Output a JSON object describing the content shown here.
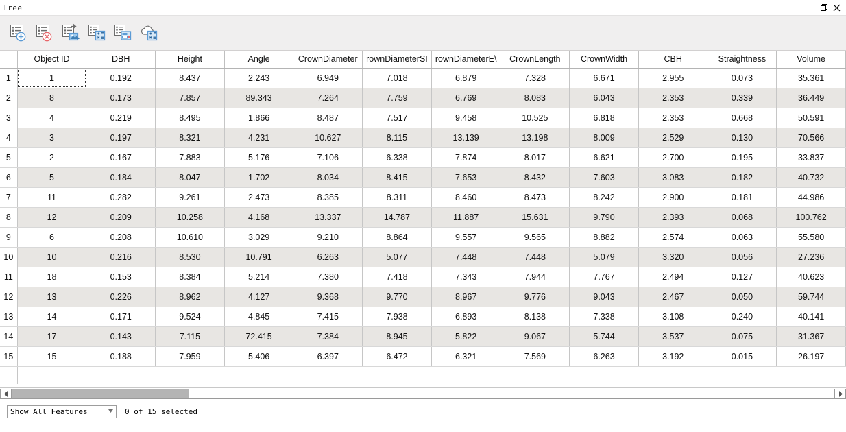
{
  "window": {
    "title": "Tree",
    "restore_icon": "restore-window-icon",
    "close_icon": "close-icon"
  },
  "toolbar": {
    "buttons": [
      {
        "name": "add-record-button",
        "icon": "list-add-icon",
        "title": "Add Record"
      },
      {
        "name": "delete-record-button",
        "icon": "list-delete-icon",
        "title": "Delete Record"
      },
      {
        "name": "export-records-button",
        "icon": "list-export-icon",
        "title": "Export Records"
      },
      {
        "name": "add-field-button",
        "icon": "list-calculate-icon",
        "title": "Add Field"
      },
      {
        "name": "delete-field-button",
        "icon": "list-remove-field-icon",
        "title": "Delete Field"
      },
      {
        "name": "calculate-field-button",
        "icon": "cloud-calculate-icon",
        "title": "Calculate Field"
      }
    ]
  },
  "table": {
    "columns": [
      "Object ID",
      "DBH",
      "Height",
      "Angle",
      "CrownDiameter",
      "rownDiameterSI",
      "rownDiameterE\\",
      "CrownLength",
      "CrownWidth",
      "CBH",
      "Straightness",
      "Volume"
    ],
    "row_numbers": [
      "1",
      "2",
      "3",
      "4",
      "5",
      "6",
      "7",
      "8",
      "9",
      "10",
      "11",
      "12",
      "13",
      "14",
      "15"
    ],
    "rows": [
      [
        "1",
        "0.192",
        "8.437",
        "2.243",
        "6.949",
        "7.018",
        "6.879",
        "7.328",
        "6.671",
        "2.955",
        "0.073",
        "35.361"
      ],
      [
        "8",
        "0.173",
        "7.857",
        "89.343",
        "7.264",
        "7.759",
        "6.769",
        "8.083",
        "6.043",
        "2.353",
        "0.339",
        "36.449"
      ],
      [
        "4",
        "0.219",
        "8.495",
        "1.866",
        "8.487",
        "7.517",
        "9.458",
        "10.525",
        "6.818",
        "2.353",
        "0.668",
        "50.591"
      ],
      [
        "3",
        "0.197",
        "8.321",
        "4.231",
        "10.627",
        "8.115",
        "13.139",
        "13.198",
        "8.009",
        "2.529",
        "0.130",
        "70.566"
      ],
      [
        "2",
        "0.167",
        "7.883",
        "5.176",
        "7.106",
        "6.338",
        "7.874",
        "8.017",
        "6.621",
        "2.700",
        "0.195",
        "33.837"
      ],
      [
        "5",
        "0.184",
        "8.047",
        "1.702",
        "8.034",
        "8.415",
        "7.653",
        "8.432",
        "7.603",
        "3.083",
        "0.182",
        "40.732"
      ],
      [
        "11",
        "0.282",
        "9.261",
        "2.473",
        "8.385",
        "8.311",
        "8.460",
        "8.473",
        "8.242",
        "2.900",
        "0.181",
        "44.986"
      ],
      [
        "12",
        "0.209",
        "10.258",
        "4.168",
        "13.337",
        "14.787",
        "11.887",
        "15.631",
        "9.790",
        "2.393",
        "0.068",
        "100.762"
      ],
      [
        "6",
        "0.208",
        "10.610",
        "3.029",
        "9.210",
        "8.864",
        "9.557",
        "9.565",
        "8.882",
        "2.574",
        "0.063",
        "55.580"
      ],
      [
        "10",
        "0.216",
        "8.530",
        "10.791",
        "6.263",
        "5.077",
        "7.448",
        "7.448",
        "5.079",
        "3.320",
        "0.056",
        "27.236"
      ],
      [
        "18",
        "0.153",
        "8.384",
        "5.214",
        "7.380",
        "7.418",
        "7.343",
        "7.944",
        "7.767",
        "2.494",
        "0.127",
        "40.623"
      ],
      [
        "13",
        "0.226",
        "8.962",
        "4.127",
        "9.368",
        "9.770",
        "8.967",
        "9.776",
        "9.043",
        "2.467",
        "0.050",
        "59.744"
      ],
      [
        "14",
        "0.171",
        "9.524",
        "4.845",
        "7.415",
        "7.938",
        "6.893",
        "8.138",
        "7.338",
        "3.108",
        "0.240",
        "40.141"
      ],
      [
        "17",
        "0.143",
        "7.115",
        "72.415",
        "7.384",
        "8.945",
        "5.822",
        "9.067",
        "5.744",
        "3.537",
        "0.075",
        "31.367"
      ],
      [
        "15",
        "0.188",
        "7.959",
        "5.406",
        "6.397",
        "6.472",
        "6.321",
        "7.569",
        "6.263",
        "3.192",
        "0.015",
        "26.197"
      ]
    ]
  },
  "scrollbar": {
    "left_arrow_icon": "scroll-left-icon",
    "right_arrow_icon": "scroll-right-icon"
  },
  "footer": {
    "filter_value": "Show All Features",
    "filter_arrow_icon": "chevron-down-icon",
    "status": "0 of 15 selected"
  },
  "colors": {
    "toolbar_bg": "#f0efef",
    "alt_row_bg": "#e8e6e3",
    "grid_line": "#c6c6c6",
    "icon_blue": "#5b9bd5",
    "icon_red": "#e8666a"
  }
}
